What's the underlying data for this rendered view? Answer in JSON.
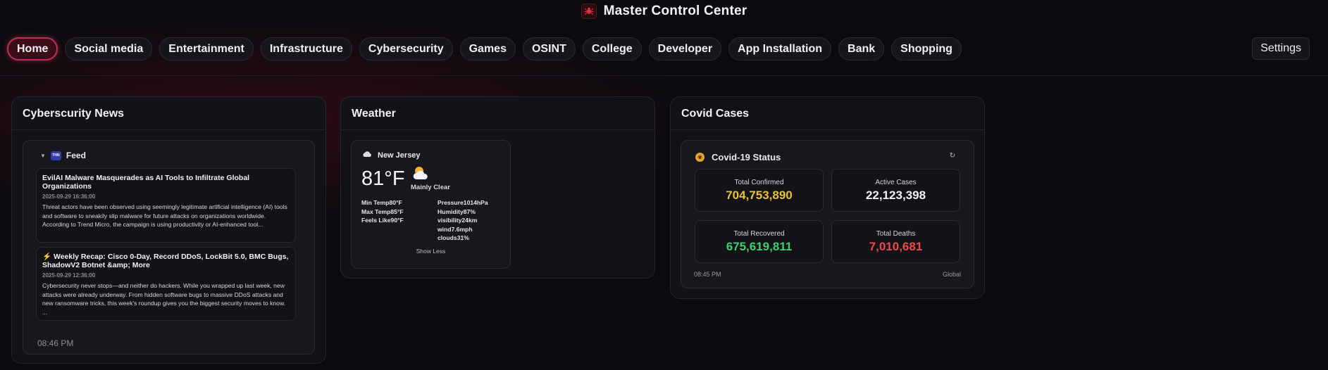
{
  "app": {
    "title": "Master Control Center",
    "logo_icon": "spider-icon"
  },
  "nav": {
    "items": [
      {
        "label": "Home",
        "active": true
      },
      {
        "label": "Social media"
      },
      {
        "label": "Entertainment"
      },
      {
        "label": "Infrastructure"
      },
      {
        "label": "Cybersecurity"
      },
      {
        "label": "Games"
      },
      {
        "label": "OSINT"
      },
      {
        "label": "College"
      },
      {
        "label": "Developer"
      },
      {
        "label": "App Installation"
      },
      {
        "label": "Bank"
      },
      {
        "label": "Shopping"
      }
    ],
    "settings_label": "Settings"
  },
  "news": {
    "title": "Cyberscurity News",
    "feed_label": "Feed",
    "feed_logo": "THN",
    "articles": [
      {
        "title": "EvilAI Malware Masquerades as AI Tools to Infiltrate Global Organizations",
        "date": "2025-09-29 16:36:00",
        "desc": "Threat actors have been observed using seemingly legitimate artificial intelligence (AI) tools and software to sneakily slip malware for future attacks on organizations worldwide. According to Trend Micro, the campaign is using productivity or AI-enhanced tool..."
      },
      {
        "title": "Weekly Recap: Cisco 0-Day, Record DDoS, LockBit 5.0, BMC Bugs, ShadowV2 Botnet &amp; More",
        "date": "2025-09-29 12:36:00",
        "desc": "Cybersecurity never stops—and neither do hackers. While you wrapped up last week, new attacks were already underway. From hidden software bugs to massive DDoS attacks and new ransomware tricks, this week's roundup gives you the biggest security moves to know. ..."
      }
    ],
    "time": "08:46 PM"
  },
  "weather": {
    "title": "Weather",
    "location": "New Jersey",
    "temp": "81°F",
    "condition": "Mainly Clear",
    "left": [
      "Min Temp80°F",
      "Max Temp85°F",
      "Feels Like90°F"
    ],
    "right": [
      "Pressure1014hPa",
      "Humidity87%",
      "visibility24km",
      "wind7.6mph",
      "clouds31%"
    ],
    "toggle_label": "Show Less"
  },
  "covid": {
    "title": "Covid Cases",
    "status_title": "Covid-19 Status",
    "refresh_icon": "↻",
    "stats": {
      "confirmed": {
        "label": "Total Confirmed",
        "value": "704,753,890",
        "color": "#e6c23a"
      },
      "active": {
        "label": "Active Cases",
        "value": "22,123,398",
        "color": "#f3f3f6"
      },
      "recovered": {
        "label": "Total Recovered",
        "value": "675,619,811",
        "color": "#3ccf6e"
      },
      "deaths": {
        "label": "Total Deaths",
        "value": "7,010,681",
        "color": "#ec4a4a"
      }
    },
    "time": "08:45 PM",
    "scope": "Global"
  }
}
